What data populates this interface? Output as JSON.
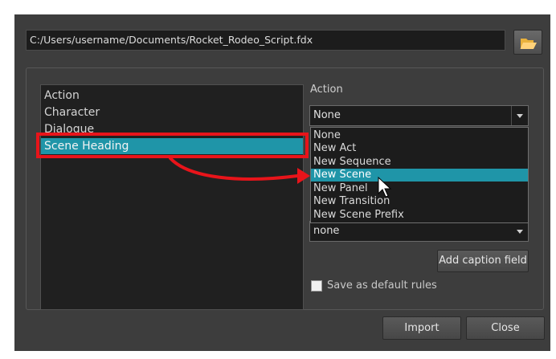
{
  "file_path": "C:/Users/username/Documents/Rocket_Rodeo_Script.fdx",
  "type_list": {
    "items": [
      "Action",
      "Character",
      "Dialogue",
      "Scene Heading"
    ],
    "selected": "Scene Heading"
  },
  "action": {
    "label": "Action",
    "value": "None",
    "options": [
      "None",
      "New Act",
      "New Sequence",
      "New Scene",
      "New Panel",
      "New Transition",
      "New Scene Prefix"
    ],
    "highlighted": "New Scene"
  },
  "second_combo": {
    "value": "none"
  },
  "buttons": {
    "add_caption": "Add caption field",
    "import": "Import",
    "close": "Close"
  },
  "save_default": {
    "label": "Save as default rules",
    "checked": false
  },
  "icons": {
    "browse": "folder-open-icon",
    "pointer": "mouse-cursor-icon",
    "annotation": "curved-arrow-icon"
  },
  "colors": {
    "selection": "#1f95a8",
    "annotation": "#e8141a",
    "dialog_bg": "#3d3d3d"
  }
}
